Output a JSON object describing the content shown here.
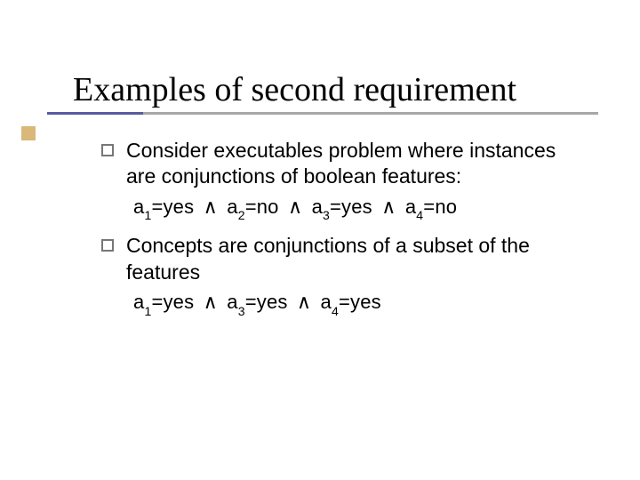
{
  "title": "Examples of second requirement",
  "bullets": [
    {
      "text": "Consider executables problem where instances are conjunctions of boolean features:",
      "formula": {
        "a1": "a",
        "s1": "1",
        "v1": "=yes",
        "and": "∧",
        "a2": "a",
        "s2": "2",
        "v2": "=no",
        "a3": "a",
        "s3": "3",
        "v3": "=yes",
        "a4": "a",
        "s4": "4",
        "v4": "=no"
      }
    },
    {
      "text": "Concepts are conjunctions of a subset of the features",
      "formula": {
        "a1": "a",
        "s1": "1",
        "v1": "=yes",
        "and": "∧",
        "a3": "a",
        "s3": "3",
        "v3": "=yes",
        "a4": "a",
        "s4": "4",
        "v4": "=yes"
      }
    }
  ]
}
